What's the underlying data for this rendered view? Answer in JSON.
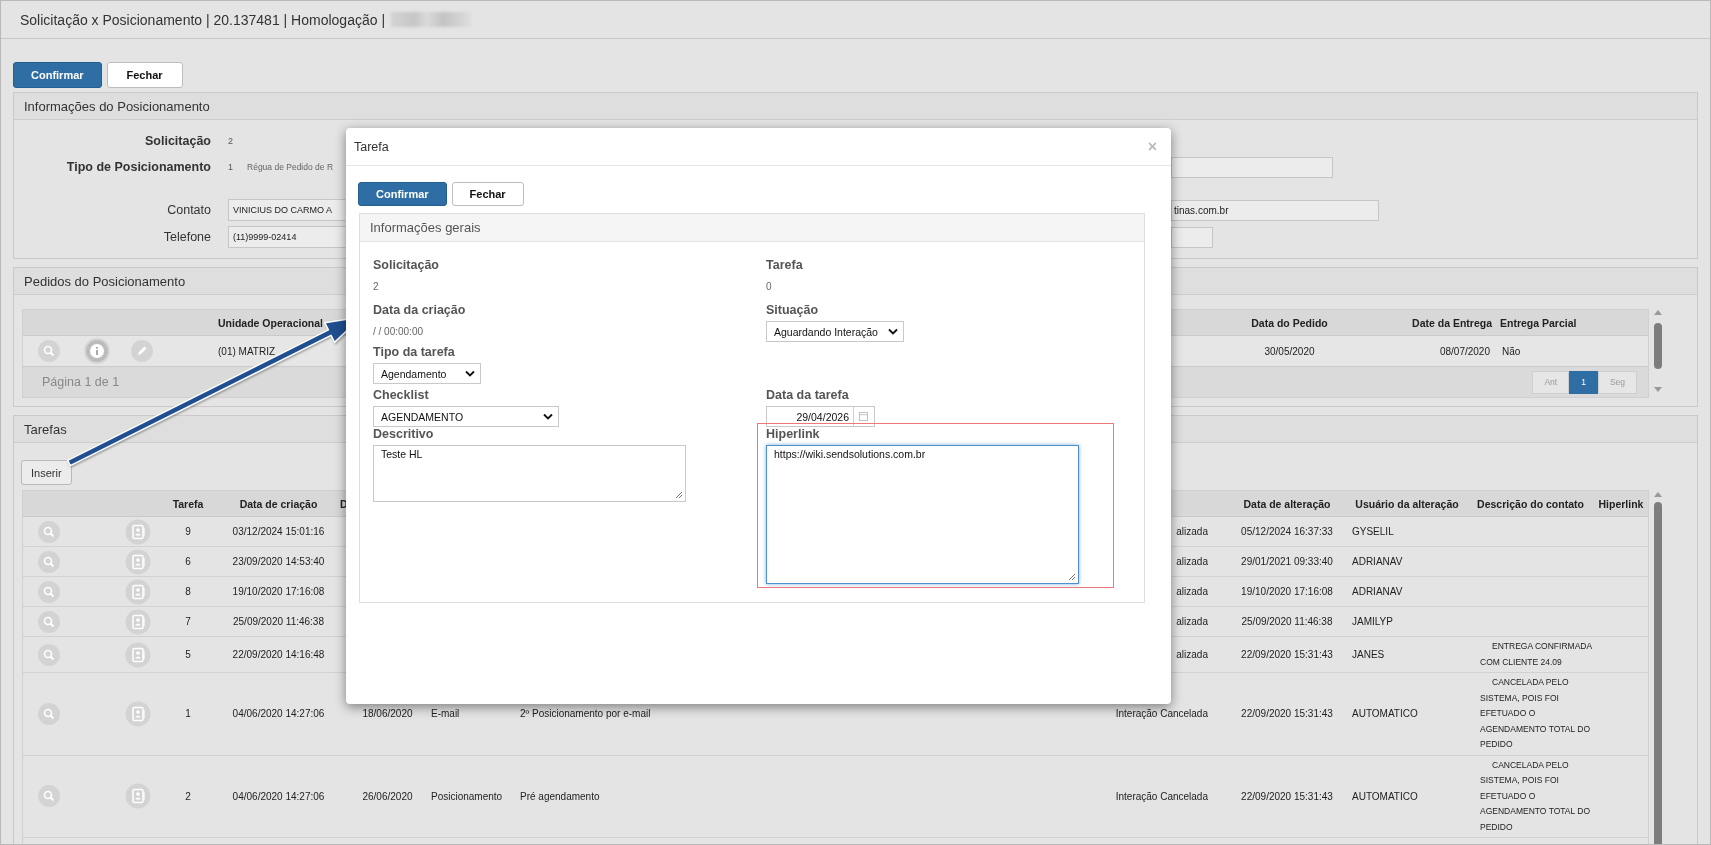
{
  "window": {
    "title": "Solicitação x Posicionamento | 20.137481 | Homologação |"
  },
  "toolbar": [
    {
      "label": "Confirmar",
      "kind": "primary"
    },
    {
      "label": "Fechar",
      "kind": "default"
    }
  ],
  "info": {
    "title": "Informações do Posicionamento",
    "rows": [
      {
        "label": "Solicitação",
        "kind": "text",
        "value": "2"
      },
      {
        "label": "Tipo de Posicionamento",
        "kind": "text",
        "value": "1",
        "detail": "Régua de Pedido de R",
        "side_field": true
      },
      {
        "label": "Contato",
        "kind": "input",
        "value": "VINICIUS DO CARMO A",
        "side_value": "tinas.com.br"
      },
      {
        "label": "Telefone",
        "kind": "input",
        "value": "(11)9999-02414",
        "side_field": true
      }
    ]
  },
  "orders": {
    "title": "Pedidos do Posicionamento",
    "header": {
      "unidade_operacional": "Unidade Operacional",
      "data_do_pedido": "Data do Pedido",
      "date_da_entrega": "Date da Entrega",
      "entrega_parcial": "Entrega Parcial"
    },
    "rows": [
      {
        "unidade_operacional": "(01) MATRIZ",
        "data_do_pedido": "30/05/2020",
        "date_da_entrega": "08/07/2020",
        "entrega_parcial": "Não"
      }
    ],
    "pager": {
      "text": "Página 1 de 1",
      "buttons": [
        {
          "label": "Ant",
          "selected": false
        },
        {
          "label": "1",
          "selected": true
        },
        {
          "label": "Seg",
          "selected": false
        }
      ]
    }
  },
  "tasks": {
    "title": "Tarefas",
    "insert_button": "Inserir",
    "header": {
      "tarefa": "Tarefa",
      "data_criacao": "Data de criação",
      "column_3": "D",
      "data_alteracao": "Data de alteração",
      "usuario_alteracao": "Usuário da alteração",
      "descricao_contato": "Descrição do contato",
      "hiperlink": "Hiperlink"
    },
    "rows": [
      {
        "tarefa": "9",
        "data_criacao": "03/12/2024 15:01:16",
        "column_6": "alizada",
        "data_alteracao": "05/12/2024 16:37:33",
        "usuario_alteracao": "GYSELIL"
      },
      {
        "tarefa": "6",
        "data_criacao": "23/09/2020 14:53:40",
        "column_6": "alizada",
        "data_alteracao": "29/01/2021 09:33:40",
        "usuario_alteracao": "ADRIANAV"
      },
      {
        "tarefa": "8",
        "data_criacao": "19/10/2020 17:16:08",
        "column_6": "alizada",
        "data_alteracao": "19/10/2020 17:16:08",
        "usuario_alteracao": "ADRIANAV"
      },
      {
        "tarefa": "7",
        "data_criacao": "25/09/2020 11:46:38",
        "column_6": "alizada",
        "data_alteracao": "25/09/2020 11:46:38",
        "usuario_alteracao": "JAMILYP"
      },
      {
        "tarefa": "5",
        "data_criacao": "22/09/2020 14:16:48",
        "column_6": "alizada",
        "data_alteracao": "22/09/2020 15:31:43",
        "usuario_alteracao": "JANES",
        "descricao_contato": "ENTREGA CONFIRMADA COM CLIENTE 24.09"
      },
      {
        "tarefa": "1",
        "data_criacao": "04/06/2020 14:27:06",
        "column_3": "18/06/2020",
        "column_4": "E-mail",
        "column_5": "2º Posicionamento por e-mail",
        "column_6": "Interação Cancelada",
        "data_alteracao": "22/09/2020 15:31:43",
        "usuario_alteracao": "AUTOMATICO",
        "descricao_contato": "CANCELADA PELO SISTEMA, POIS FOI EFETUADO O AGENDAMENTO TOTAL DO PEDIDO"
      },
      {
        "tarefa": "2",
        "data_criacao": "04/06/2020 14:27:06",
        "column_3": "26/06/2020",
        "column_4": "Posicionamento",
        "column_5": "Pré agendamento",
        "column_6": "Interação Cancelada",
        "data_alteracao": "22/09/2020 15:31:43",
        "usuario_alteracao": "AUTOMATICO",
        "descricao_contato": "CANCELADA PELO SISTEMA, POIS FOI EFETUADO O AGENDAMENTO TOTAL DO PEDIDO"
      }
    ]
  },
  "modal": {
    "title": "Tarefa",
    "close": "×",
    "buttons": [
      {
        "label": "Confirmar",
        "kind": "primary"
      },
      {
        "label": "Fechar",
        "kind": "default"
      }
    ],
    "section": {
      "title": "Informações gerais",
      "rows": [
        [
          {
            "label": "Solicitação",
            "kind": "text",
            "value": "2"
          },
          {
            "label": "Tarefa",
            "kind": "text",
            "value": "0"
          }
        ],
        [
          {
            "label": "Data da criação",
            "kind": "text",
            "value": "/ / 00:00:00"
          },
          {
            "label": "Situação",
            "kind": "select",
            "value": "Aguardando Interação"
          }
        ],
        [
          {
            "label": "Tipo da tarefa",
            "kind": "select",
            "value": "Agendamento"
          }
        ],
        [
          {
            "label": "Checklist",
            "kind": "select",
            "value": "AGENDAMENTO"
          },
          {
            "label": "Data da tarefa",
            "kind": "date",
            "value": "29/04/2026"
          }
        ],
        [
          {
            "label": "Descritivo",
            "kind": "textarea",
            "value": "Teste HL",
            "highlighted": false
          },
          {
            "label": "Hiperlink",
            "kind": "textarea",
            "value": "https://wiki.sendsolutions.com.br",
            "highlighted": true
          }
        ]
      ]
    }
  }
}
